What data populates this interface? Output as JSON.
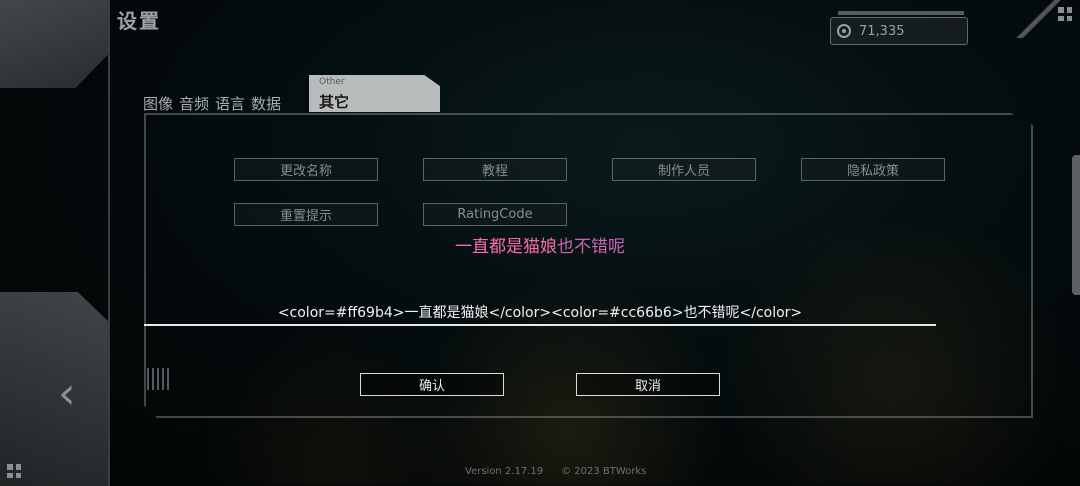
{
  "header": {
    "title": "设置"
  },
  "currency": {
    "icon": "coin-icon",
    "value": "71,335"
  },
  "tabs": [
    {
      "label": "图像"
    },
    {
      "label": "音频"
    },
    {
      "label": "语言"
    },
    {
      "label": "数据"
    }
  ],
  "active_tab": {
    "sub_label": "Other",
    "label": "其它"
  },
  "options": {
    "rename": "更改名称",
    "tutorial": "教程",
    "credits": "制作人员",
    "privacy": "隐私政策",
    "reset_tips": "重置提示",
    "rating_code": "RatingCode"
  },
  "preview": {
    "part1": "一直都是猫娘",
    "part2": "也不错呢",
    "colors": [
      "#ff69b4",
      "#cc66b6"
    ]
  },
  "input": {
    "value": "<color=#ff69b4>一直都是猫娘</color><color=#cc66b6>也不错呢</color>"
  },
  "dialog": {
    "confirm": "确认",
    "cancel": "取消"
  },
  "footer": {
    "version": "Version 2.17.19",
    "copyright": "© 2023 BTWorks"
  }
}
